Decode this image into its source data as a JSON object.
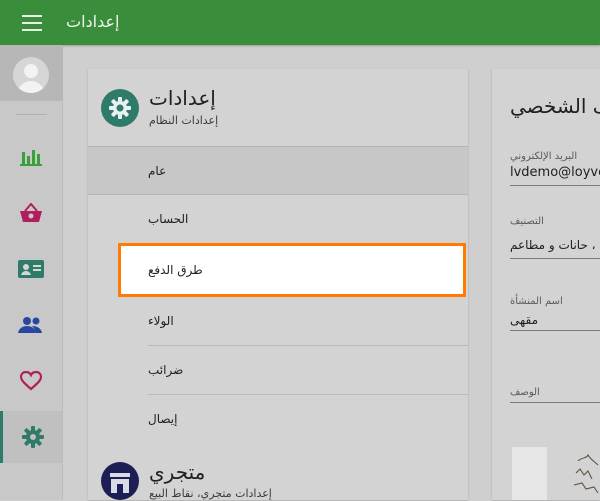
{
  "topbar": {
    "title": "إعدادات",
    "bg_color": "#3a8d3a"
  },
  "sidebar": {
    "items": [
      {
        "name": "bar-chart-icon",
        "color": "#3aa13a"
      },
      {
        "name": "basket-icon",
        "color": "#b01e5d"
      },
      {
        "name": "contact-card-icon",
        "color": "#2e7b6a"
      },
      {
        "name": "users-icon",
        "color": "#2747a0"
      },
      {
        "name": "heart-icon",
        "color": "#b01e5d"
      },
      {
        "name": "gear-icon",
        "color": "#2e7b6a",
        "active": true
      }
    ]
  },
  "settings_section": {
    "title": "إعدادات",
    "subtitle": "إعدادات النظام",
    "items": [
      {
        "label": "عام"
      },
      {
        "label": "الحساب"
      },
      {
        "label": "طرق الدفع"
      },
      {
        "label": "الولاء"
      },
      {
        "label": "ضرائب"
      },
      {
        "label": "إيصال"
      }
    ]
  },
  "store_section": {
    "title": "متجري",
    "subtitle": "إعدادات متجري، نقاط البيع"
  },
  "profile": {
    "title": "ملف الشخصي",
    "fields": [
      {
        "label": "البريد الإلكتروني",
        "value": "lvdemo@loyverse.com"
      },
      {
        "label": "التصنيف",
        "value": "مقهي ، حانات و مطاعم"
      },
      {
        "label": "اسم المنشأة",
        "value": "مقهى"
      },
      {
        "label": "الوصف",
        "value": ""
      }
    ]
  },
  "colors": {
    "accent": "#2e7b6a",
    "highlight_border": "#ff7a00"
  }
}
